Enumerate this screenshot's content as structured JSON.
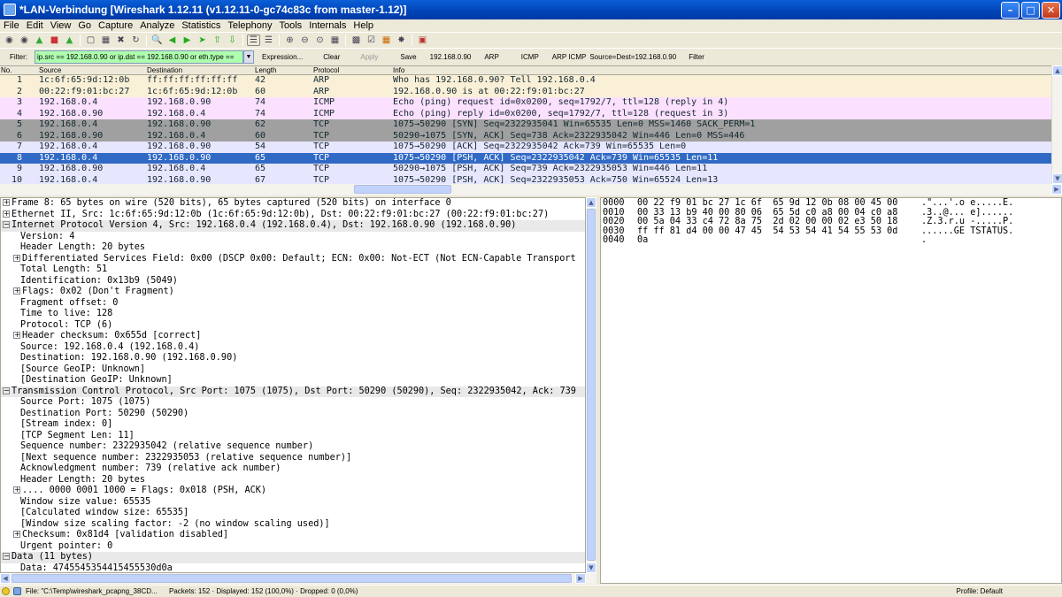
{
  "window": {
    "title": "*LAN-Verbindung   [Wireshark 1.12.11  (v1.12.11-0-gc74c83c from master-1.12)]"
  },
  "menu": [
    "File",
    "Edit",
    "View",
    "Go",
    "Capture",
    "Analyze",
    "Statistics",
    "Telephony",
    "Tools",
    "Internals",
    "Help"
  ],
  "filter": {
    "label": "Filter:",
    "value": "ip.src == 192.168.0.90 or ip.dst == 192.168.0.90 or eth.type ==",
    "buttons": [
      {
        "label": "Expression...",
        "enabled": true
      },
      {
        "label": "Clear",
        "enabled": true
      },
      {
        "label": "Apply",
        "enabled": false
      },
      {
        "label": "Save",
        "enabled": true
      },
      {
        "label": "192.168.0.90",
        "enabled": true
      },
      {
        "label": "ARP",
        "enabled": true
      },
      {
        "label": "ICMP",
        "enabled": true
      },
      {
        "label": "ARP ICMP",
        "enabled": true
      },
      {
        "label": "Source=Dest=192.168.0.90",
        "enabled": true
      },
      {
        "label": "Filter",
        "enabled": true
      }
    ]
  },
  "packet_list": {
    "columns": [
      "No.",
      "Source",
      "Destination",
      "Length",
      "Protocol",
      "Info"
    ],
    "rows": [
      {
        "no": "1",
        "src": "1c:6f:65:9d:12:0b",
        "dst": "ff:ff:ff:ff:ff:ff",
        "len": "42",
        "proto": "ARP",
        "info": "Who has 192.168.0.90?  Tell 192.168.0.4",
        "bg": "#faf0d7",
        "fg": "#12272e"
      },
      {
        "no": "2",
        "src": "00:22:f9:01:bc:27",
        "dst": "1c:6f:65:9d:12:0b",
        "len": "60",
        "proto": "ARP",
        "info": "192.168.0.90 is at 00:22:f9:01:bc:27",
        "bg": "#faf0d7",
        "fg": "#12272e"
      },
      {
        "no": "3",
        "src": "192.168.0.4",
        "dst": "192.168.0.90",
        "len": "74",
        "proto": "ICMP",
        "info": "Echo (ping) request  id=0x0200, seq=1792/7, ttl=128 (reply in 4)",
        "bg": "#fce0ff",
        "fg": "#12272e"
      },
      {
        "no": "4",
        "src": "192.168.0.90",
        "dst": "192.168.0.4",
        "len": "74",
        "proto": "ICMP",
        "info": "Echo (ping) reply    id=0x0200, seq=1792/7, ttl=128 (request in 3)",
        "bg": "#fce0ff",
        "fg": "#12272e"
      },
      {
        "no": "5",
        "src": "192.168.0.4",
        "dst": "192.168.0.90",
        "len": "62",
        "proto": "TCP",
        "info": "1075→50290 [SYN] Seq=2322935041 Win=65535 Len=0 MSS=1460 SACK_PERM=1",
        "bg": "#a0a0a0",
        "fg": "#12272e"
      },
      {
        "no": "6",
        "src": "192.168.0.90",
        "dst": "192.168.0.4",
        "len": "60",
        "proto": "TCP",
        "info": "50290→1075 [SYN, ACK] Seq=738 Ack=2322935042 Win=446 Len=0 MSS=446",
        "bg": "#a0a0a0",
        "fg": "#12272e"
      },
      {
        "no": "7",
        "src": "192.168.0.4",
        "dst": "192.168.0.90",
        "len": "54",
        "proto": "TCP",
        "info": "1075→50290 [ACK] Seq=2322935042 Ack=739 Win=65535 Len=0",
        "bg": "#e7e6ff",
        "fg": "#12272e"
      },
      {
        "no": "8",
        "src": "192.168.0.4",
        "dst": "192.168.0.90",
        "len": "65",
        "proto": "TCP",
        "info": "1075→50290 [PSH, ACK] Seq=2322935042 Ack=739 Win=65535 Len=11",
        "bg": "#316ac5",
        "fg": "#ffffff"
      },
      {
        "no": "9",
        "src": "192.168.0.90",
        "dst": "192.168.0.4",
        "len": "65",
        "proto": "TCP",
        "info": "50290→1075 [PSH, ACK] Seq=739 Ack=2322935053 Win=446 Len=11",
        "bg": "#e7e6ff",
        "fg": "#12272e"
      },
      {
        "no": "10",
        "src": "192.168.0.4",
        "dst": "192.168.0.90",
        "len": "67",
        "proto": "TCP",
        "info": "1075→50290 [PSH, ACK] Seq=2322935053 Ack=750 Win=65524 Len=13",
        "bg": "#e7e6ff",
        "fg": "#12272e"
      }
    ]
  },
  "details": [
    {
      "text": "Frame 8: 65 bytes on wire (520 bits), 65 bytes captured (520 bits) on interface 0",
      "indent": 0,
      "expander": "+",
      "hl": false
    },
    {
      "text": "Ethernet II, Src: 1c:6f:65:9d:12:0b (1c:6f:65:9d:12:0b), Dst: 00:22:f9:01:bc:27 (00:22:f9:01:bc:27)",
      "indent": 0,
      "expander": "+",
      "hl": false
    },
    {
      "text": "Internet Protocol Version 4, Src: 192.168.0.4 (192.168.0.4), Dst: 192.168.0.90 (192.168.0.90)",
      "indent": 0,
      "expander": "-",
      "hl": true
    },
    {
      "text": "Version: 4",
      "indent": 1,
      "expander": "",
      "hl": false
    },
    {
      "text": "Header Length: 20 bytes",
      "indent": 1,
      "expander": "",
      "hl": false
    },
    {
      "text": "Differentiated Services Field: 0x00 (DSCP 0x00: Default; ECN: 0x00: Not-ECT (Not ECN-Capable Transport",
      "indent": 1,
      "expander": "+",
      "hl": false
    },
    {
      "text": "Total Length: 51",
      "indent": 1,
      "expander": "",
      "hl": false
    },
    {
      "text": "Identification: 0x13b9 (5049)",
      "indent": 1,
      "expander": "",
      "hl": false
    },
    {
      "text": "Flags: 0x02 (Don't Fragment)",
      "indent": 1,
      "expander": "+",
      "hl": false
    },
    {
      "text": "Fragment offset: 0",
      "indent": 1,
      "expander": "",
      "hl": false
    },
    {
      "text": "Time to live: 128",
      "indent": 1,
      "expander": "",
      "hl": false
    },
    {
      "text": "Protocol: TCP (6)",
      "indent": 1,
      "expander": "",
      "hl": false
    },
    {
      "text": "Header checksum: 0x655d [correct]",
      "indent": 1,
      "expander": "+",
      "hl": false
    },
    {
      "text": "Source: 192.168.0.4 (192.168.0.4)",
      "indent": 1,
      "expander": "",
      "hl": false
    },
    {
      "text": "Destination: 192.168.0.90 (192.168.0.90)",
      "indent": 1,
      "expander": "",
      "hl": false
    },
    {
      "text": "[Source GeoIP: Unknown]",
      "indent": 1,
      "expander": "",
      "hl": false
    },
    {
      "text": "[Destination GeoIP: Unknown]",
      "indent": 1,
      "expander": "",
      "hl": false
    },
    {
      "text": "Transmission Control Protocol, Src Port: 1075 (1075), Dst Port: 50290 (50290), Seq: 2322935042, Ack: 739",
      "indent": 0,
      "expander": "-",
      "hl": true
    },
    {
      "text": "Source Port: 1075 (1075)",
      "indent": 1,
      "expander": "",
      "hl": false
    },
    {
      "text": "Destination Port: 50290 (50290)",
      "indent": 1,
      "expander": "",
      "hl": false
    },
    {
      "text": "[Stream index: 0]",
      "indent": 1,
      "expander": "",
      "hl": false
    },
    {
      "text": "[TCP Segment Len: 11]",
      "indent": 1,
      "expander": "",
      "hl": false
    },
    {
      "text": "Sequence number: 2322935042    (relative sequence number)",
      "indent": 1,
      "expander": "",
      "hl": false
    },
    {
      "text": "[Next sequence number: 2322935053    (relative sequence number)]",
      "indent": 1,
      "expander": "",
      "hl": false
    },
    {
      "text": "Acknowledgment number: 739    (relative ack number)",
      "indent": 1,
      "expander": "",
      "hl": false
    },
    {
      "text": "Header Length: 20 bytes",
      "indent": 1,
      "expander": "",
      "hl": false
    },
    {
      "text": ".... 0000 0001 1000 = Flags: 0x018 (PSH, ACK)",
      "indent": 1,
      "expander": "+",
      "hl": false
    },
    {
      "text": "Window size value: 65535",
      "indent": 1,
      "expander": "",
      "hl": false
    },
    {
      "text": "[Calculated window size: 65535]",
      "indent": 1,
      "expander": "",
      "hl": false
    },
    {
      "text": "[Window size scaling factor: -2 (no window scaling used)]",
      "indent": 1,
      "expander": "",
      "hl": false
    },
    {
      "text": "Checksum: 0x81d4 [validation disabled]",
      "indent": 1,
      "expander": "+",
      "hl": false
    },
    {
      "text": "Urgent pointer: 0",
      "indent": 1,
      "expander": "",
      "hl": false
    },
    {
      "text": "Data (11 bytes)",
      "indent": 0,
      "expander": "-",
      "hl": true
    },
    {
      "text": "Data: 4745545354415455530d0a",
      "indent": 1,
      "expander": "",
      "hl": false
    }
  ],
  "hex": [
    {
      "offset": "0000",
      "bytes": "00 22 f9 01 bc 27 1c 6f  65 9d 12 0b 08 00 45 00",
      "ascii": ".\"...'.o e.....E."
    },
    {
      "offset": "0010",
      "bytes": "00 33 13 b9 40 00 80 06  65 5d c0 a8 00 04 c0 a8",
      "ascii": ".3..@... e]......"
    },
    {
      "offset": "0020",
      "bytes": "00 5a 04 33 c4 72 8a 75  2d 02 00 00 02 e3 50 18",
      "ascii": ".Z.3.r.u -.....P."
    },
    {
      "offset": "0030",
      "bytes": "ff ff 81 d4 00 00 47 45  54 53 54 41 54 55 53 0d",
      "ascii": "......GE TSTATUS."
    },
    {
      "offset": "0040",
      "bytes": "0a",
      "ascii": "."
    }
  ],
  "status": {
    "file": "File: \"C:\\Temp\\wireshark_pcapng_38CD...",
    "packets": "Packets: 152 · Displayed: 152 (100,0%) · Dropped: 0 (0,0%)",
    "profile": "Profile: Default"
  },
  "colors": {
    "selected": "#316ac5",
    "filter_ok": "#afffaf",
    "title_bar": "#0043b6"
  }
}
